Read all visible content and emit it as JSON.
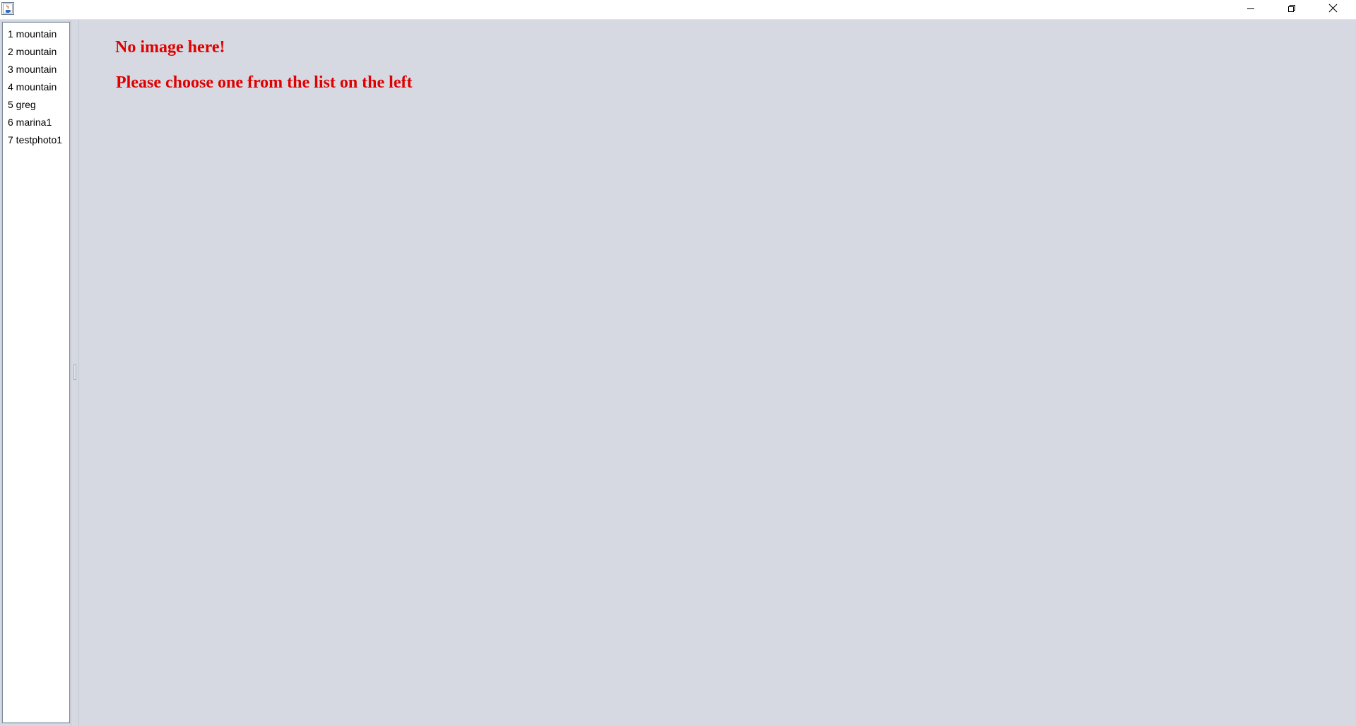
{
  "window": {
    "app_icon": "java-icon",
    "controls": {
      "minimize_icon": "minimize-icon",
      "restore_icon": "restore-icon",
      "close_icon": "close-icon"
    }
  },
  "image_list": {
    "items": [
      {
        "label": "1 mountain"
      },
      {
        "label": "2 mountain"
      },
      {
        "label": "3 mountain"
      },
      {
        "label": "4 mountain"
      },
      {
        "label": "5 greg"
      },
      {
        "label": "6 marina1"
      },
      {
        "label": "7 testphoto1"
      }
    ]
  },
  "main": {
    "title": "No image here!",
    "message": "Please choose one from the list on the left",
    "text_color": "#e00000"
  },
  "colors": {
    "background": "#d6d9e1",
    "titlebar": "#ffffff",
    "list_background": "#ffffff"
  }
}
